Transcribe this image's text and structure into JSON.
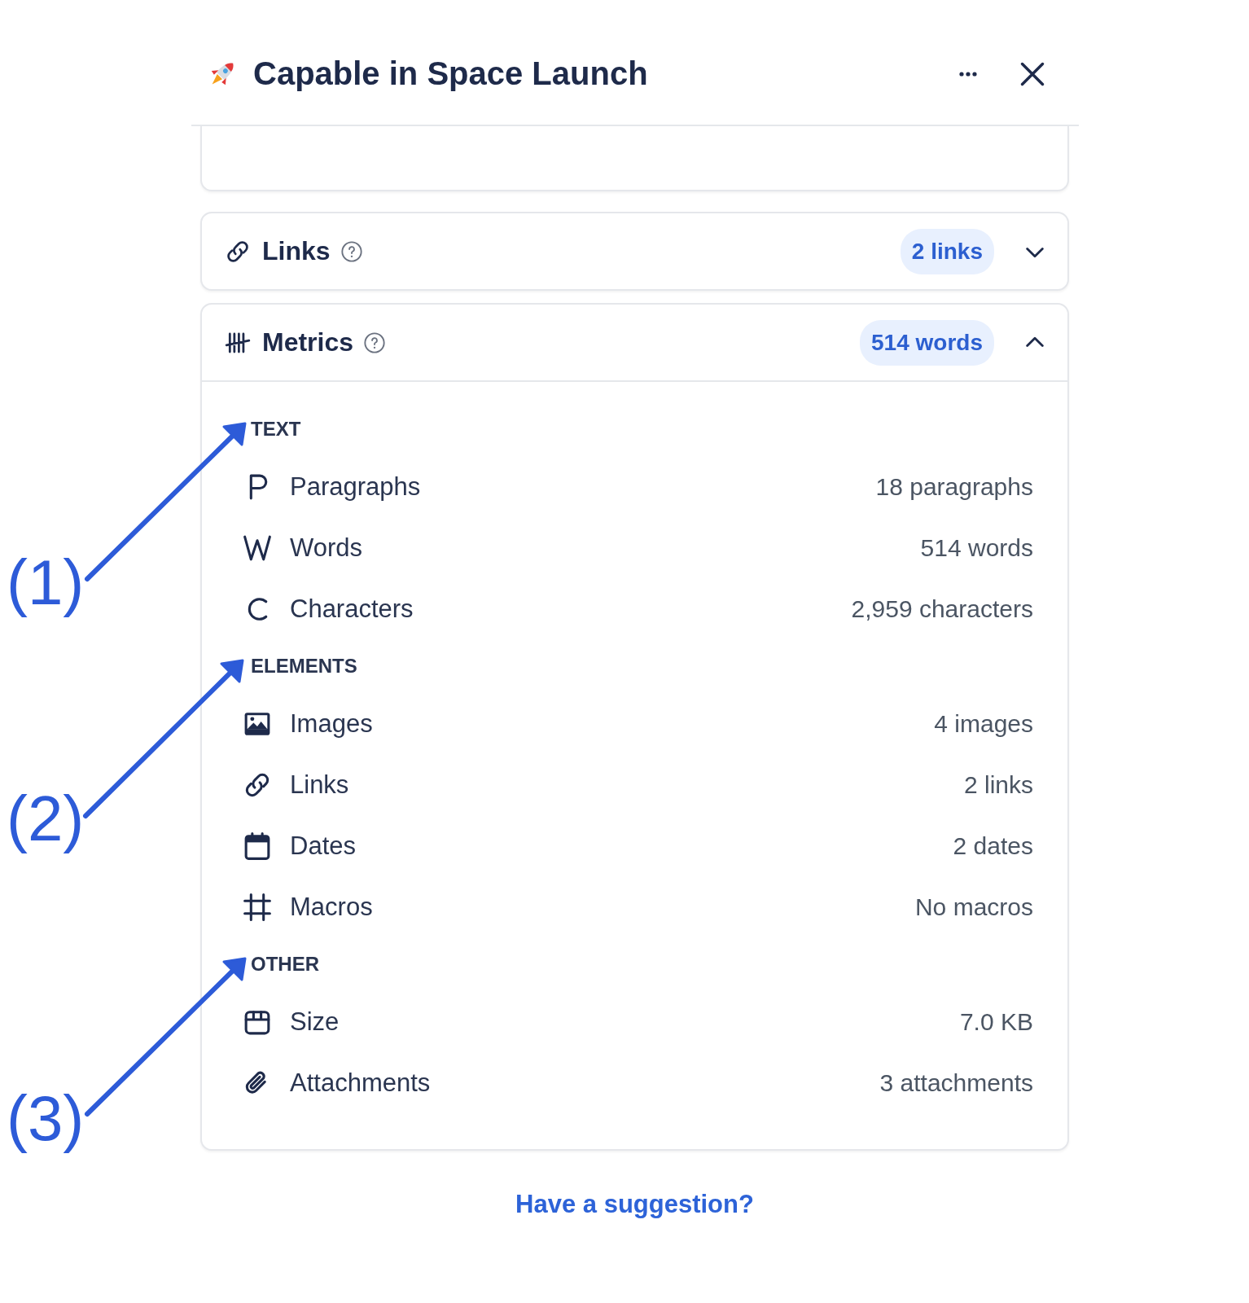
{
  "header": {
    "title": "Capable in Space Launch"
  },
  "sections": [
    {
      "kind": "links",
      "title": "Links",
      "badge": "2 links",
      "expanded": false
    },
    {
      "kind": "metrics",
      "title": "Metrics",
      "badge": "514 words",
      "expanded": true,
      "groups": [
        {
          "heading": "TEXT",
          "rows": [
            {
              "kind": "p",
              "label": "Paragraphs",
              "value": "18 paragraphs"
            },
            {
              "kind": "w",
              "label": "Words",
              "value": "514 words"
            },
            {
              "kind": "c",
              "label": "Characters",
              "value": "2,959 characters"
            }
          ]
        },
        {
          "heading": "ELEMENTS",
          "rows": [
            {
              "kind": "image",
              "label": "Images",
              "value": "4 images"
            },
            {
              "kind": "link",
              "label": "Links",
              "value": "2 links"
            },
            {
              "kind": "calendar",
              "label": "Dates",
              "value": "2 dates"
            },
            {
              "kind": "hash",
              "label": "Macros",
              "value": "No macros"
            }
          ]
        },
        {
          "heading": "OTHER",
          "rows": [
            {
              "kind": "box",
              "label": "Size",
              "value": "7.0 KB"
            },
            {
              "kind": "clip",
              "label": "Attachments",
              "value": "3 attachments"
            }
          ]
        }
      ]
    }
  ],
  "footer_link": "Have a suggestion?",
  "annotations": [
    {
      "label": "(1)"
    },
    {
      "label": "(2)"
    },
    {
      "label": "(3)"
    }
  ]
}
